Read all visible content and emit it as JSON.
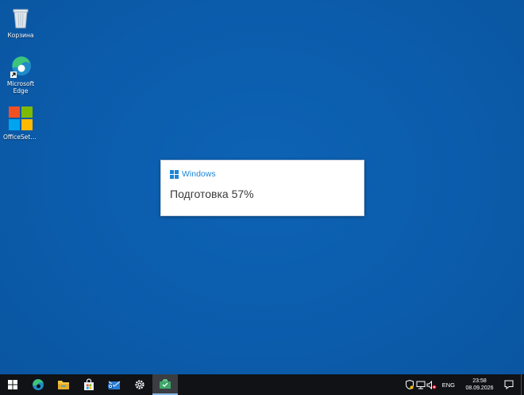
{
  "desktop": {
    "icons": [
      {
        "label": "Корзина",
        "icon": "recycle-bin-icon"
      },
      {
        "label": "Microsoft Edge",
        "icon": "edge-icon"
      },
      {
        "label": "OfficeSetu...",
        "icon": "office-setup-icon"
      }
    ]
  },
  "dialog": {
    "brand": "Windows",
    "status": "Подготовка 57%",
    "progress_percent": 57
  },
  "taskbar": {
    "apps": [
      {
        "icon": "start-icon"
      },
      {
        "icon": "edge-icon"
      },
      {
        "icon": "file-explorer-icon"
      },
      {
        "icon": "store-icon"
      },
      {
        "icon": "mail-icon"
      },
      {
        "icon": "settings-icon"
      },
      {
        "icon": "setup-app-icon",
        "active": true
      }
    ],
    "tray": {
      "language": "ENG",
      "time": "23:58",
      "date": "08.09.2026"
    }
  },
  "colors": {
    "desktop_bg": "#0b5cab",
    "taskbar_bg": "#101216",
    "brand_blue": "#1b86d6"
  }
}
